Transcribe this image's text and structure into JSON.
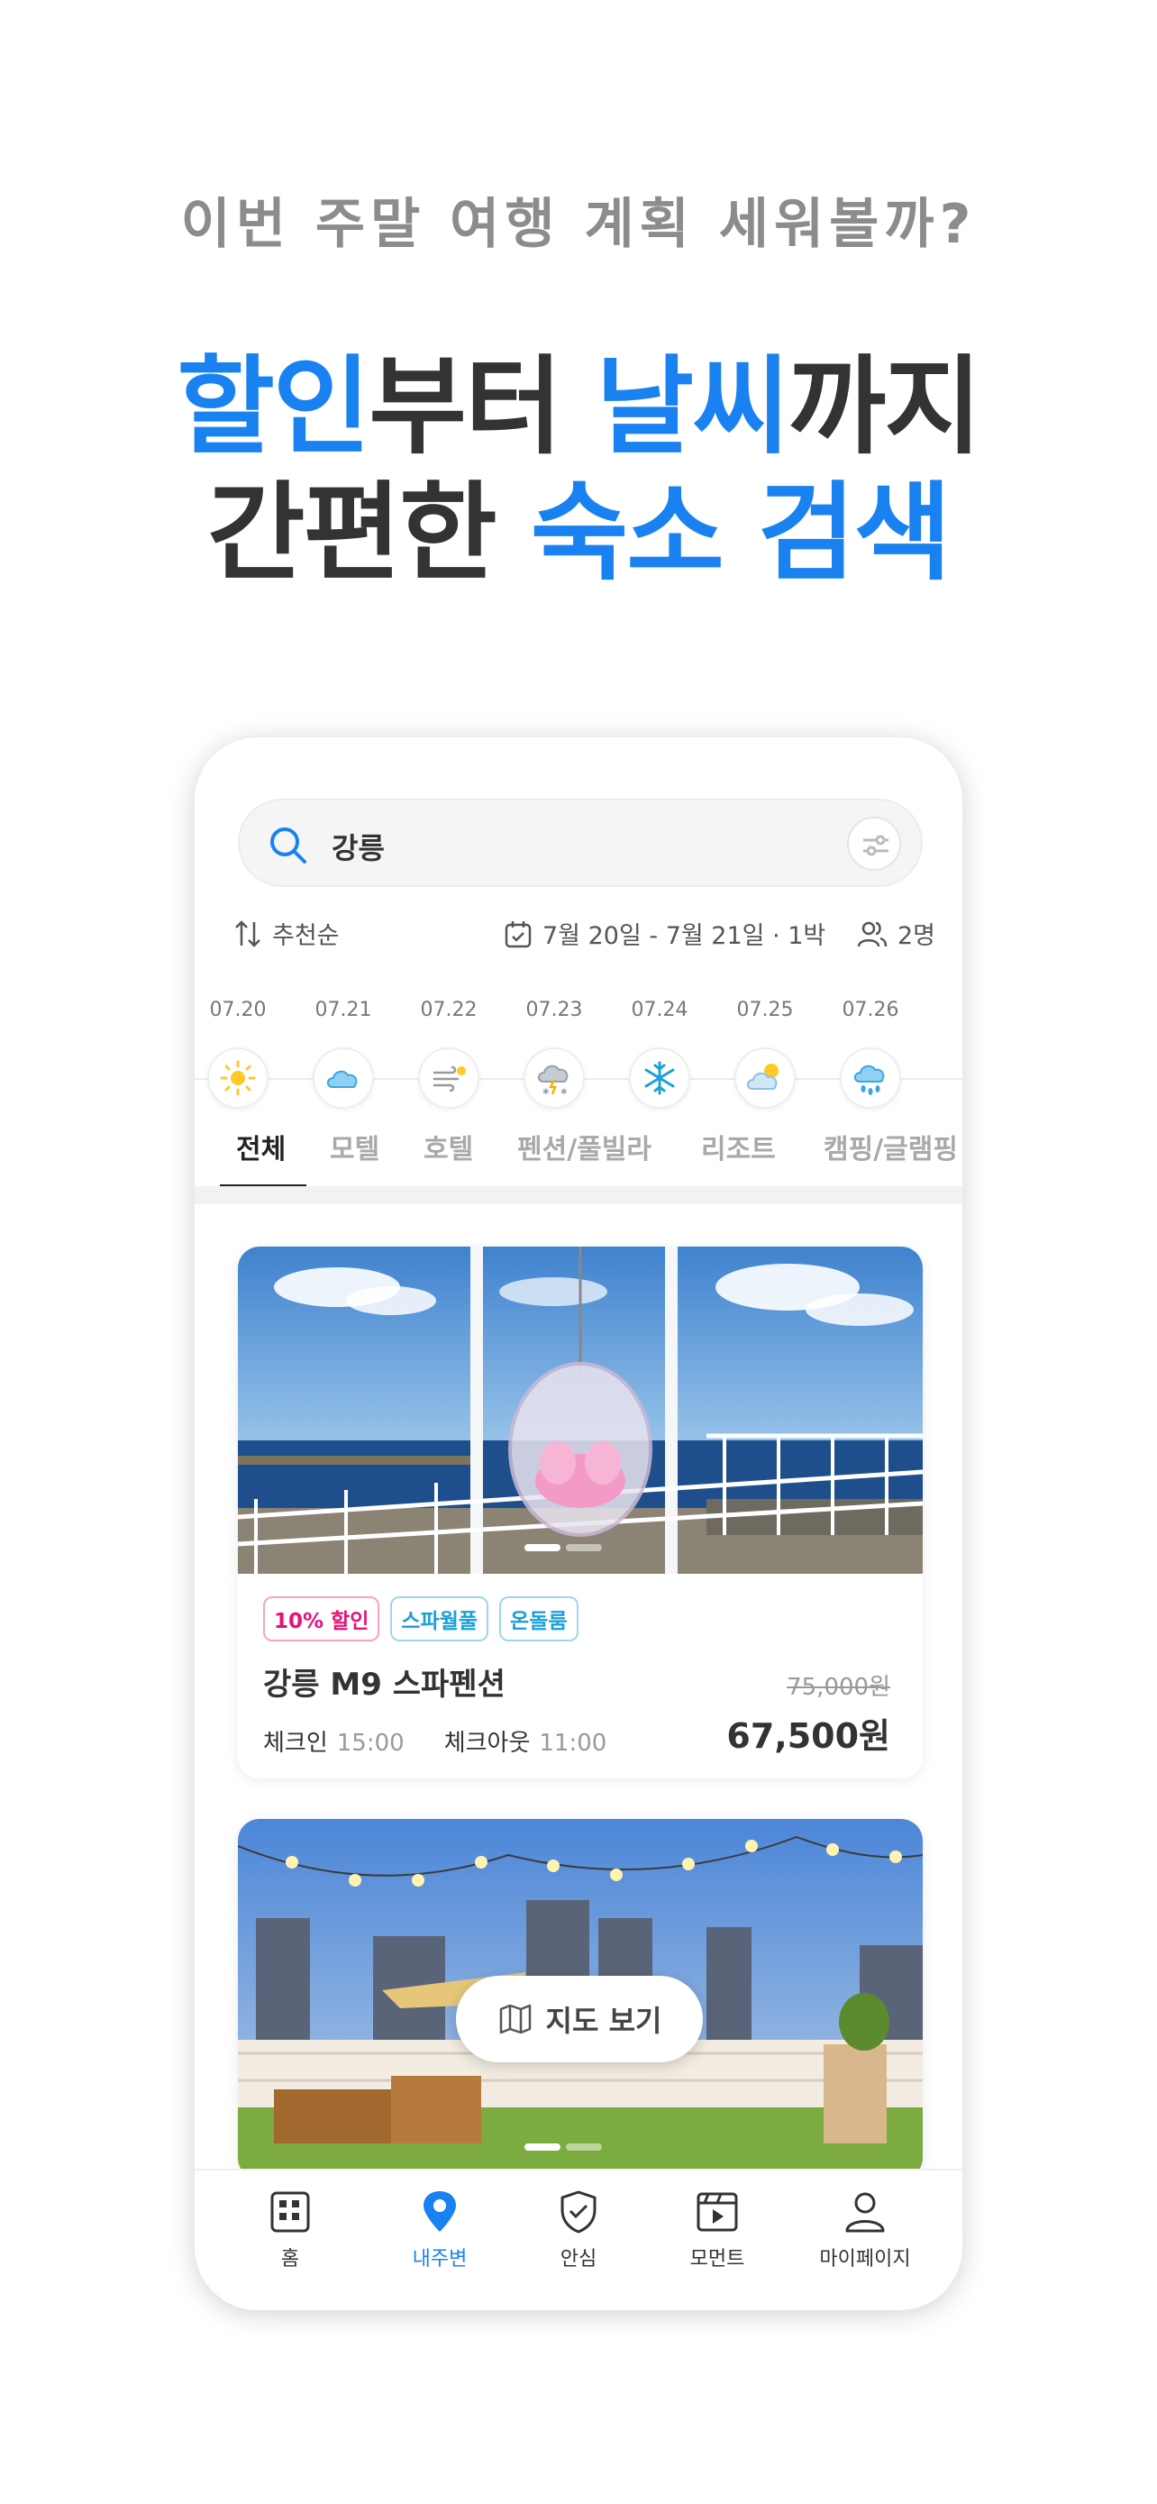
{
  "promo": {
    "subtitle": "이번 주말 여행 계획 세워볼까?",
    "line1_a": "할인",
    "line1_b": "부터 ",
    "line1_c": "날씨",
    "line1_d": "까지",
    "line2_a": "간편한 ",
    "line2_b": "숙소 검색"
  },
  "search": {
    "query": "강릉"
  },
  "options": {
    "sort_label": "추천순",
    "date_range": "7월 20일 - 7월 21일 · 1박",
    "guests": "2명"
  },
  "weather": [
    {
      "date": "07.20",
      "icon": "sun-icon"
    },
    {
      "date": "07.21",
      "icon": "cloud-icon"
    },
    {
      "date": "07.22",
      "icon": "wind-icon"
    },
    {
      "date": "07.23",
      "icon": "thunder-snow-icon"
    },
    {
      "date": "07.24",
      "icon": "snowflake-icon"
    },
    {
      "date": "07.25",
      "icon": "partly-cloudy-icon"
    },
    {
      "date": "07.26",
      "icon": "rain-icon"
    }
  ],
  "tabs": [
    "전체",
    "모텔",
    "호텔",
    "펜션/풀빌라",
    "리조트",
    "캠핑/글램핑"
  ],
  "listings": [
    {
      "tags": [
        "10% 할인",
        "스파월풀",
        "온돌룸"
      ],
      "name": "강릉 M9 스파펜션",
      "checkin_label": "체크인",
      "checkin_time": "15:00",
      "checkout_label": "체크아웃",
      "checkout_time": "11:00",
      "original_price": "75,000원",
      "price": "67,500원"
    }
  ],
  "map_button": "지도 보기",
  "nav": [
    {
      "label": "홈",
      "icon": "home-icon"
    },
    {
      "label": "내주변",
      "icon": "location-pin-icon"
    },
    {
      "label": "안심",
      "icon": "shield-check-icon"
    },
    {
      "label": "모먼트",
      "icon": "video-icon"
    },
    {
      "label": "마이페이지",
      "icon": "person-icon"
    }
  ],
  "colors": {
    "accent": "#1a82f0",
    "discount_tag": "#e6127a",
    "feature_tag": "#1ba0d8"
  }
}
